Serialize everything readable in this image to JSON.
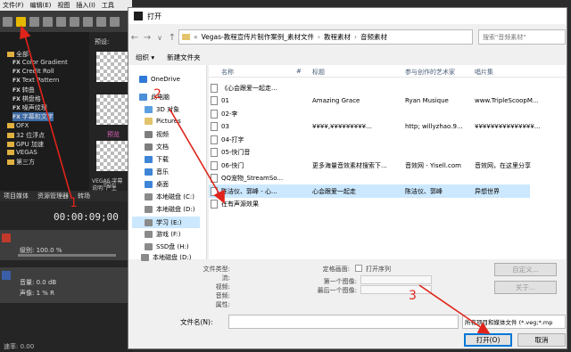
{
  "vegas": {
    "menu": [
      "文件(F)",
      "编辑(E)",
      "视图",
      "插入(I)",
      "工具"
    ],
    "preview_label": "预设:",
    "tree": [
      {
        "label": "全部",
        "kind": "folder"
      },
      {
        "label": "Color Gradient",
        "kind": "fx"
      },
      {
        "label": "Credit Roll",
        "kind": "fx"
      },
      {
        "label": "Text Pattern",
        "kind": "fx"
      },
      {
        "label": "转曲",
        "kind": "fx"
      },
      {
        "label": "棋盘格",
        "kind": "fx"
      },
      {
        "label": "噪声纹理",
        "kind": "fx"
      },
      {
        "label": "字幕和文字",
        "kind": "fx"
      },
      {
        "label": "OFX",
        "kind": "folder"
      },
      {
        "label": "32 位浮点",
        "kind": "folder"
      },
      {
        "label": "GPU 加速",
        "kind": "folder"
      },
      {
        "label": "VEGAS",
        "kind": "folder"
      },
      {
        "label": "第三方",
        "kind": "folder"
      }
    ],
    "fx_tag": "FX",
    "thumb_text": [
      "预览",
      "欧闪"
    ],
    "panel_caption_1": "VEGAS 字幕",
    "panel_caption_2": "说明: 产生",
    "tabs": [
      "项目媒体",
      "资源管理器",
      "转场"
    ],
    "timecode": "00:00:09;00",
    "track1": {
      "label": "级别:",
      "value": "100.0 %"
    },
    "track2": {
      "vol_label": "音量:",
      "vol_value": "0.0 dB",
      "pan_label": "声像:",
      "pan_value": "1 % R"
    },
    "status": "速率: 0.00"
  },
  "dialog": {
    "title": "打开",
    "address": [
      "Vegas-教程宣传片制作案例_素材文件",
      "教程素材",
      "音频素材"
    ],
    "search_placeholder": "搜索\"音频素材\"",
    "organize": "组织 ▾",
    "new_folder": "新建文件夹",
    "nav": [
      {
        "label": "OneDrive",
        "color": "#2f7ad8"
      },
      {
        "label": "此电脑",
        "color": "#4a8fd8"
      },
      {
        "label": "3D 对象",
        "color": "#5aa0e0"
      },
      {
        "label": "Pictures",
        "color": "#e3c36b"
      },
      {
        "label": "视频",
        "color": "#7d7d7d"
      },
      {
        "label": "文档",
        "color": "#7d7d7d"
      },
      {
        "label": "下载",
        "color": "#3d85d6"
      },
      {
        "label": "音乐",
        "color": "#3d85d6"
      },
      {
        "label": "桌面",
        "color": "#3d85d6"
      },
      {
        "label": "本地磁盘 (C:)",
        "color": "#8a8a8a"
      },
      {
        "label": "本地磁盘 (D:)",
        "color": "#8a8a8a"
      },
      {
        "label": "学习 (E:)",
        "color": "#8a8a8a"
      },
      {
        "label": "游戏 (F:)",
        "color": "#8a8a8a"
      },
      {
        "label": "SSD盘 (H:)",
        "color": "#8a8a8a"
      },
      {
        "label": "本地磁盘 (D:)",
        "color": "#8a8a8a"
      }
    ],
    "columns": [
      "名称",
      "#",
      "标题",
      "参与创作的艺术家",
      "唱片集"
    ],
    "files": [
      {
        "name": "《心会跟爱一起走...",
        "num": "",
        "title": "",
        "artist": "",
        "album": ""
      },
      {
        "name": "01",
        "num": "",
        "title": "Amazing Grace",
        "artist": "Ryan Musique",
        "album": "www.TripleScoopM..."
      },
      {
        "name": "02-李",
        "num": "",
        "title": "",
        "artist": "",
        "album": ""
      },
      {
        "name": "03",
        "num": "",
        "title": "¥¥¥¥,¥¥¥¥¥¥¥¥¥...",
        "artist": "http; willyzhao.9...",
        "album": "¥¥¥¥¥¥¥¥¥¥¥¥¥¥¥..."
      },
      {
        "name": "04-打字",
        "num": "",
        "title": "",
        "artist": "",
        "album": ""
      },
      {
        "name": "05-快门音",
        "num": "",
        "title": "",
        "artist": "",
        "album": ""
      },
      {
        "name": "06-快门",
        "num": "",
        "title": "更多海量音效素材搜索下...",
        "artist": "音效网 - Yisell.com",
        "album": "音效网，在这里分享"
      },
      {
        "name": "QQ宠物_StreamSo...",
        "num": "",
        "title": "",
        "artist": "",
        "album": ""
      },
      {
        "name": "陈洁仪、郭峰 - 心...",
        "num": "",
        "title": "心会跟爱一起走",
        "artist": "陈洁仪、郭峰",
        "album": "异想世界"
      },
      {
        "name": "在有声源效果",
        "num": "",
        "title": "",
        "artist": "",
        "album": ""
      }
    ],
    "info": {
      "type_label": "文件类型:",
      "stream_label": "流:",
      "video_label": "视频:",
      "audio_label": "音频:",
      "attr_label": "属性:",
      "still_label": "定格画面:",
      "open_seq": "打开序列",
      "first_img": "第一个图像:",
      "last_img": "最后一个图像:",
      "custom": "自定义...",
      "about": "关于..."
    },
    "filename_label": "文件名(N):",
    "filename_value": "",
    "filetype_value": "所有项目和媒体文件 (*.veg;*.mp",
    "open_button": "打开(O)",
    "cancel_button": "取消",
    "annotations": [
      "1",
      "2",
      "3"
    ],
    "annotation_color": "#e0241b"
  }
}
